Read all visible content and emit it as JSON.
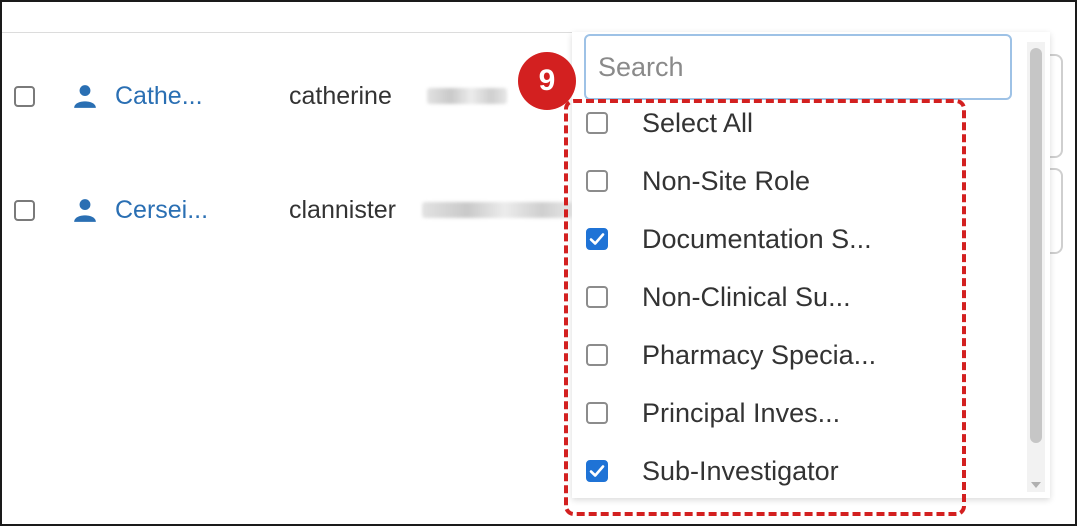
{
  "table": {
    "rows": [
      {
        "name": "Cathe...",
        "email": "catherine"
      },
      {
        "name": "Cersei...",
        "email": "clannister"
      }
    ]
  },
  "dropdown": {
    "search_placeholder": "Search",
    "options": [
      {
        "label": "Select All",
        "checked": false
      },
      {
        "label": "Non-Site Role",
        "checked": false
      },
      {
        "label": "Documentation S...",
        "checked": true
      },
      {
        "label": "Non-Clinical Su...",
        "checked": false
      },
      {
        "label": "Pharmacy Specia...",
        "checked": false
      },
      {
        "label": "Principal Inves...",
        "checked": false
      },
      {
        "label": "Sub-Investigator",
        "checked": true
      }
    ]
  },
  "annotation": {
    "step": "9",
    "color": "#d32020"
  },
  "colors": {
    "link": "#2a6fb3",
    "checkbox_checked": "#1f73d6"
  }
}
